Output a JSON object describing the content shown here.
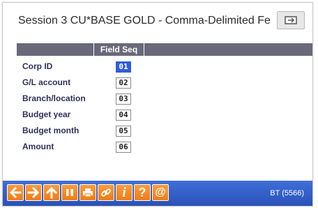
{
  "window": {
    "title": "Session 3 CU*BASE GOLD - Comma-Delimited Fe"
  },
  "grid": {
    "column_header": "Field Seq",
    "rows": [
      {
        "label": "Corp ID",
        "seq": "01",
        "active": true
      },
      {
        "label": "G/L account",
        "seq": "02"
      },
      {
        "label": "Branch/location",
        "seq": "03"
      },
      {
        "label": "Budget year",
        "seq": "04"
      },
      {
        "label": "Budget month",
        "seq": "05"
      },
      {
        "label": "Amount",
        "seq": "06"
      }
    ]
  },
  "footer": {
    "buttons": [
      "back-arrow-icon",
      "forward-arrow-icon",
      "up-arrow-icon",
      "pause-icon",
      "print-icon",
      "link-icon",
      "info-icon",
      "help-icon",
      "email-icon"
    ],
    "help_glyph": "?",
    "info_glyph": "i",
    "at_glyph": "@",
    "code": "BT (5566)"
  },
  "colors": {
    "footer_bg": "#2d5bc4",
    "button_orange": "#f5841f",
    "header_gray": "#69697a",
    "label_text": "#30305a"
  }
}
